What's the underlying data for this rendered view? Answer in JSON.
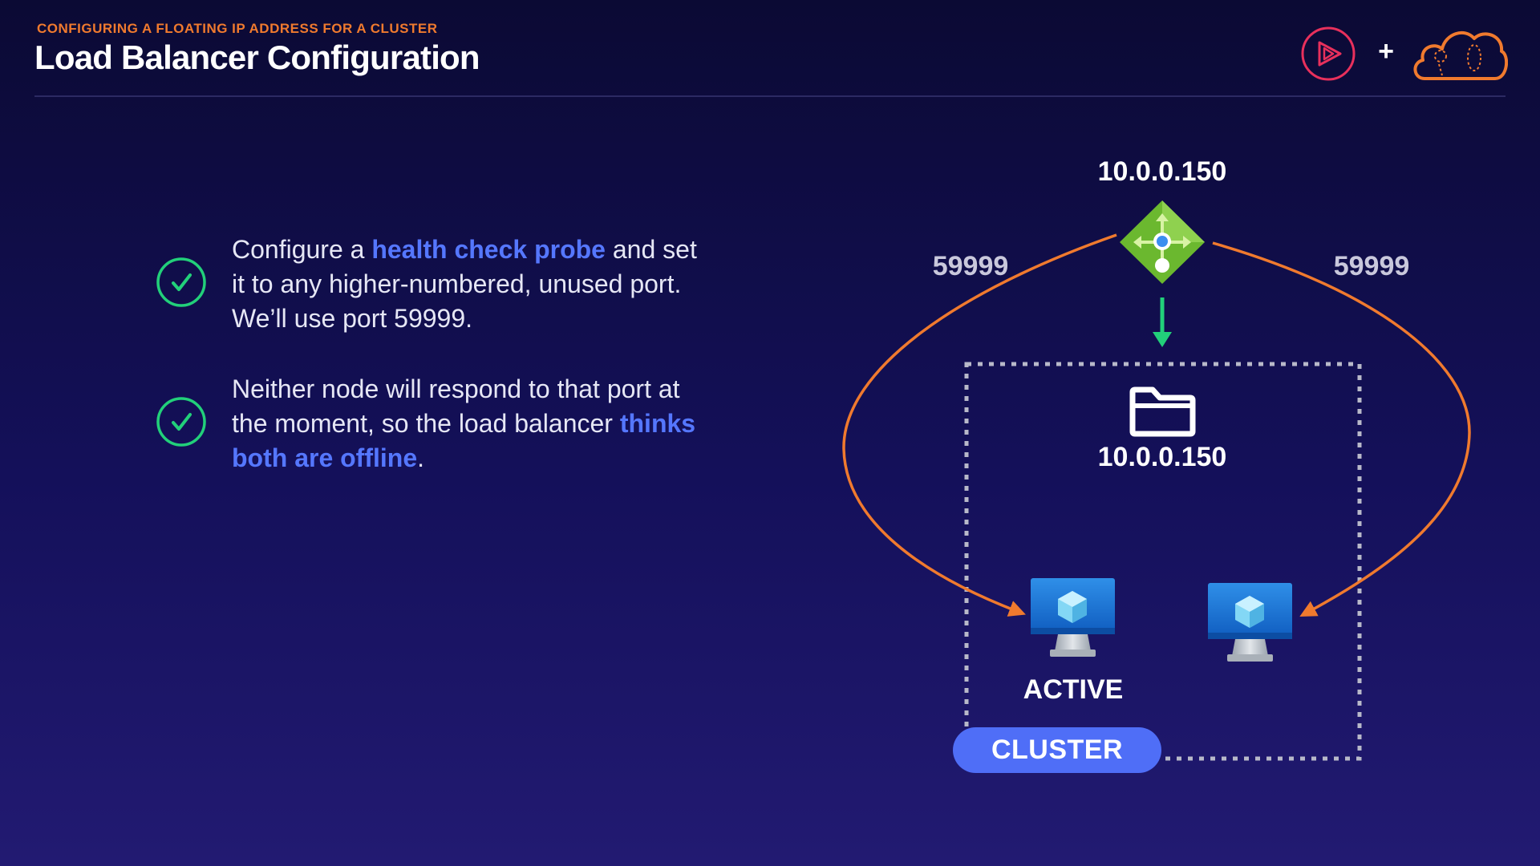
{
  "header": {
    "kicker": "CONFIGURING A FLOATING IP ADDRESS FOR A CLUSTER",
    "title": "Load Balancer Configuration",
    "plus": "+"
  },
  "bullets": [
    {
      "icon": "check-circle-icon",
      "text_before": "Configure a ",
      "highlight": "health check probe",
      "text_after": " and set it to any higher-numbered, unused port. We’ll use port 59999."
    },
    {
      "icon": "check-circle-icon",
      "text_before": "Neither node will respond to that port at the moment, so the load balancer ",
      "highlight": "thinks both are offline",
      "text_after": "."
    }
  ],
  "diagram": {
    "load_balancer_ip": "10.0.0.150",
    "cluster_ip": "10.0.0.150",
    "port_left": "59999",
    "port_right": "59999",
    "active_label": "ACTIVE",
    "cluster_label": "CLUSTER",
    "icons": [
      "load-balancer-icon",
      "folder-icon",
      "virtual-machine-icon",
      "virtual-machine-icon"
    ]
  },
  "colors": {
    "accent_orange": "#f07a2e",
    "highlight_blue": "#5577ff",
    "check_green": "#22d07a",
    "cluster_pill": "#4f6ef7",
    "brand_pink": "#e8305c"
  }
}
